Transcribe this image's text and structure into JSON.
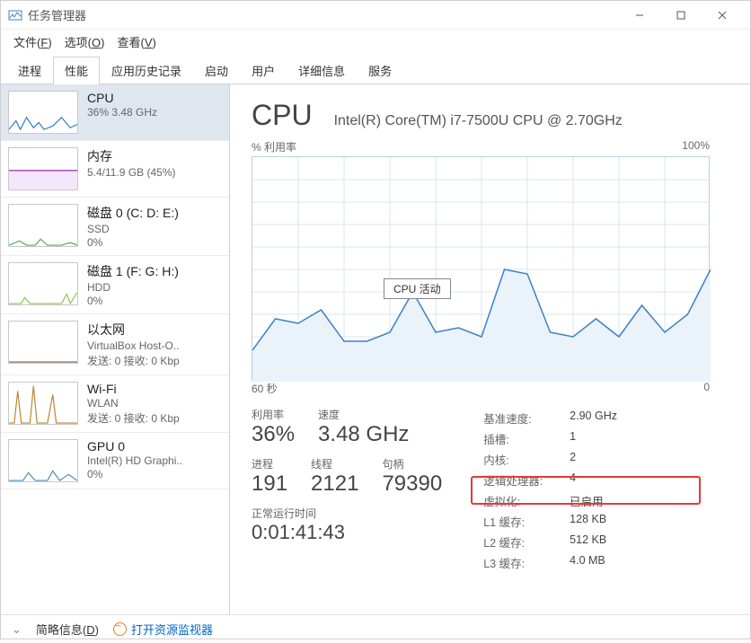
{
  "window": {
    "title": "任务管理器"
  },
  "menu": {
    "file": {
      "label": "文件",
      "hotkey": "F"
    },
    "options": {
      "label": "选项",
      "hotkey": "O"
    },
    "view": {
      "label": "查看",
      "hotkey": "V"
    }
  },
  "tabs": {
    "items": [
      {
        "label": "进程"
      },
      {
        "label": "性能"
      },
      {
        "label": "应用历史记录"
      },
      {
        "label": "启动"
      },
      {
        "label": "用户"
      },
      {
        "label": "详细信息"
      },
      {
        "label": "服务"
      }
    ],
    "active_index": 1
  },
  "sidebar": {
    "items": [
      {
        "title": "CPU",
        "sub1": "36% 3.48 GHz",
        "sub2": "",
        "color": "#3b82c4"
      },
      {
        "title": "内存",
        "sub1": "5.4/11.9 GB (45%)",
        "sub2": "",
        "color": "#9c27b0"
      },
      {
        "title": "磁盘 0 (C: D: E:)",
        "sub1": "SSD",
        "sub2": "0%",
        "color": "#4caf50"
      },
      {
        "title": "磁盘 1 (F: G: H:)",
        "sub1": "HDD",
        "sub2": "0%",
        "color": "#8bc34a"
      },
      {
        "title": "以太网",
        "sub1": "VirtualBox Host-O..",
        "sub2": "发送: 0 接收: 0 Kbp",
        "color": "#795548"
      },
      {
        "title": "Wi-Fi",
        "sub1": "WLAN",
        "sub2": "发送: 0 接收: 0 Kbp",
        "color": "#c08030"
      },
      {
        "title": "GPU 0",
        "sub1": "Intel(R) HD Graphi..",
        "sub2": "0%",
        "color": "#4a88b8"
      }
    ],
    "selected_index": 0
  },
  "detail": {
    "title": "CPU",
    "subtitle": "Intel(R) Core(TM) i7-7500U CPU @ 2.70GHz",
    "chart": {
      "y_label": "% 利用率",
      "y_max": "100%",
      "x_left": "60 秒",
      "x_right": "0",
      "callout": "CPU 活动"
    },
    "big_stats": {
      "util": {
        "label": "利用率",
        "val": "36%"
      },
      "speed": {
        "label": "速度",
        "val": "3.48 GHz"
      },
      "proc": {
        "label": "进程",
        "val": "191"
      },
      "threads": {
        "label": "线程",
        "val": "2121"
      },
      "handles": {
        "label": "句柄",
        "val": "79390"
      }
    },
    "uptime": {
      "label": "正常运行时间",
      "val": "0:01:41:43"
    },
    "info": {
      "base_speed": {
        "label": "基准速度:",
        "val": "2.90 GHz"
      },
      "sockets": {
        "label": "插槽:",
        "val": "1"
      },
      "cores": {
        "label": "内核:",
        "val": "2"
      },
      "logical": {
        "label": "逻辑处理器:",
        "val": "4"
      },
      "virt": {
        "label": "虚拟化:",
        "val": "已启用"
      },
      "l1": {
        "label": "L1 缓存:",
        "val": "128 KB"
      },
      "l2": {
        "label": "L2 缓存:",
        "val": "512 KB"
      },
      "l3": {
        "label": "L3 缓存:",
        "val": "4.0 MB"
      }
    }
  },
  "footer": {
    "brief": {
      "label": "简略信息",
      "hotkey": "D"
    },
    "resmon": "打开资源监视器"
  },
  "chart_data": {
    "type": "line",
    "title": "CPU % 利用率",
    "xlabel": "秒",
    "ylabel": "% 利用率",
    "ylim": [
      0,
      100
    ],
    "xlim": [
      60,
      0
    ],
    "x": [
      60,
      57,
      54,
      51,
      48,
      45,
      42,
      39,
      36,
      33,
      30,
      27,
      24,
      21,
      18,
      15,
      12,
      9,
      6,
      3,
      0
    ],
    "values": [
      14,
      28,
      26,
      32,
      18,
      18,
      22,
      40,
      22,
      24,
      20,
      50,
      48,
      22,
      20,
      28,
      20,
      34,
      22,
      30,
      50
    ]
  },
  "colors": {
    "accent": "#3b82c4",
    "grid": "#d9e4ee",
    "highlight": "#e53935"
  }
}
